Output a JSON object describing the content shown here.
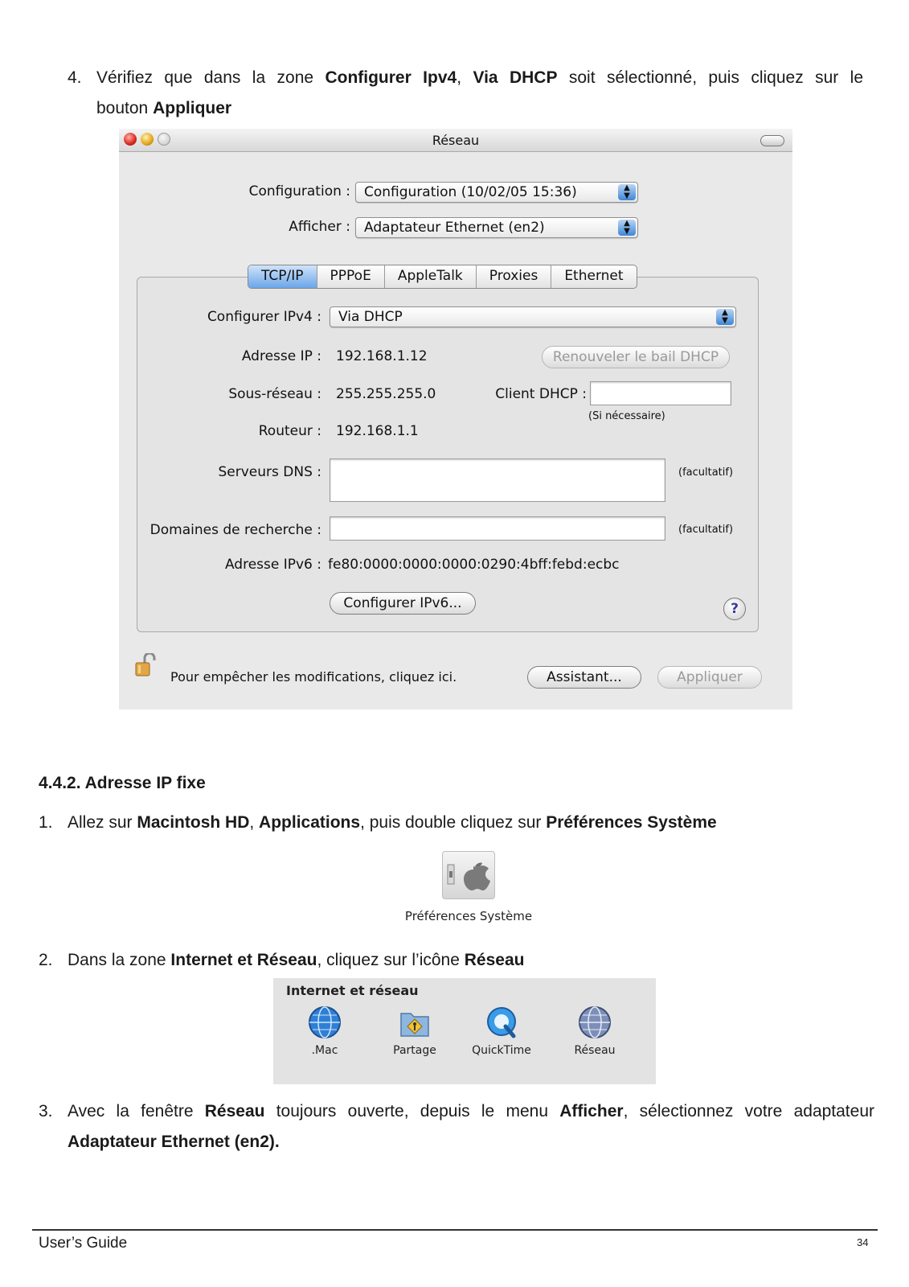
{
  "step4": {
    "number": "4.",
    "parts": [
      "Vérifiez que dans la zone ",
      "Configurer Ipv4",
      ", ",
      "Via DHCP",
      " soit sélectionné, puis cliquez sur le",
      "bouton ",
      "Appliquer"
    ]
  },
  "window": {
    "title": "Réseau",
    "configuration_label": "Configuration :",
    "configuration_value": "Configuration (10/02/05 15:36)",
    "afficher_label": "Afficher :",
    "afficher_value": "Adaptateur Ethernet (en2)",
    "tabs": [
      "TCP/IP",
      "PPPoE",
      "AppleTalk",
      "Proxies",
      "Ethernet"
    ],
    "configurer_ipv4_label": "Configurer IPv4 :",
    "configurer_ipv4_value": "Via DHCP",
    "adresse_ip_label": "Adresse IP :",
    "adresse_ip_value": "192.168.1.12",
    "renew_button": "Renouveler le bail DHCP",
    "sous_reseau_label": "Sous-réseau :",
    "sous_reseau_value": "255.255.255.0",
    "client_dhcp_label": "Client DHCP :",
    "si_necessaire": "(Si nécessaire)",
    "routeur_label": "Routeur :",
    "routeur_value": "192.168.1.1",
    "serveurs_dns_label": "Serveurs DNS :",
    "facultatif_dns": "(facultatif)",
    "domaines_label": "Domaines de recherche :",
    "facultatif_domaines": "(facultatif)",
    "adresse_ipv6_label": "Adresse IPv6 :",
    "adresse_ipv6_value": "fe80:0000:0000:0000:0290:4bff:febd:ecbc",
    "configurer_ipv6_button": "Configurer IPv6...",
    "help": "?",
    "lock_text": "Pour empêcher les modifications, cliquez ici.",
    "assistant_button": "Assistant...",
    "appliquer_button": "Appliquer"
  },
  "section_heading": "4.4.2. Adresse IP fixe",
  "step1": {
    "number": "1.",
    "parts": [
      "Allez sur ",
      "Macintosh HD",
      ", ",
      "Applications",
      ", puis double cliquez sur ",
      "Préférences Système"
    ]
  },
  "pref_icon_label": "Préférences Système",
  "step2": {
    "number": "2.",
    "parts": [
      "Dans la zone ",
      "Internet et Réseau",
      ", cliquez sur l’icône ",
      "Réseau"
    ]
  },
  "internet_panel": {
    "title": "Internet et réseau",
    "items": [
      ".Mac",
      "Partage",
      "QuickTime",
      "Réseau"
    ]
  },
  "step3": {
    "number": "3.",
    "parts": [
      "Avec la fenêtre ",
      "Réseau",
      " toujours ouverte, depuis le menu ",
      "Afficher",
      ", sélectionnez votre adaptateur",
      "Adaptateur Ethernet (en2)."
    ]
  },
  "footer": {
    "left": "User’s Guide",
    "page": "34"
  }
}
